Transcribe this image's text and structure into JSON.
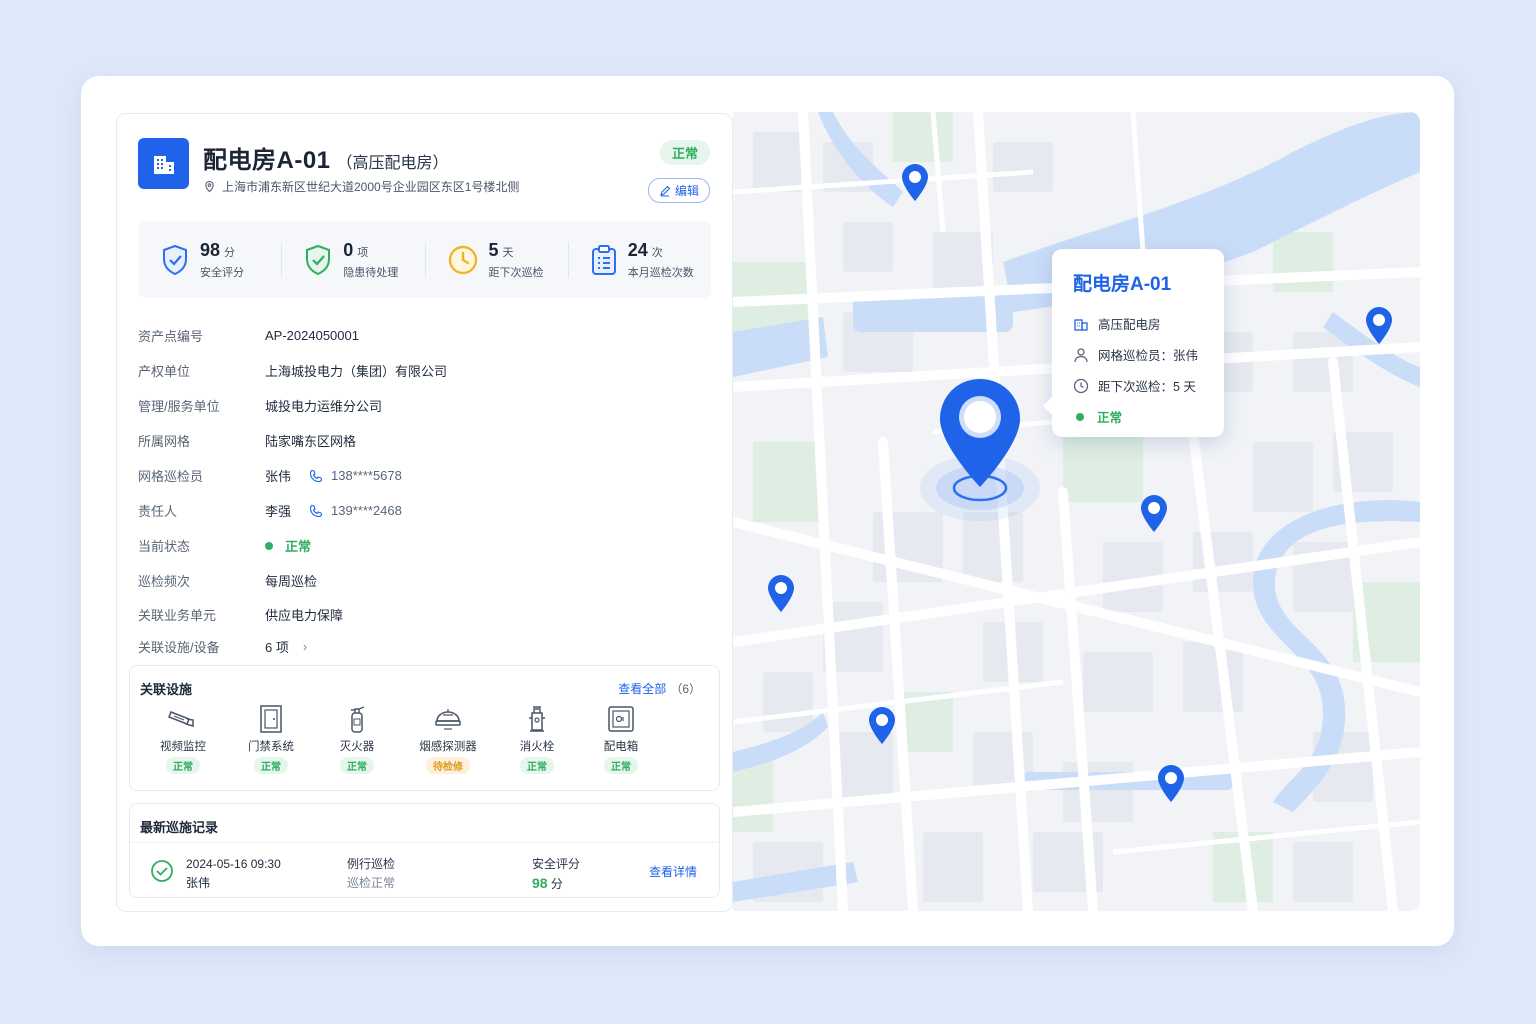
{
  "header": {
    "title": "配电房A-01",
    "subtitle": "（高压配电房）",
    "address": "上海市浦东新区世纪大道2000号企业园区东区1号楼北侧",
    "status": "正常",
    "edit_label": "编辑",
    "icon": "building-icon"
  },
  "stats": [
    {
      "value": "98",
      "unit": "分",
      "label": "安全评分",
      "icon": "shield-check-icon",
      "color": "#2d6ff0"
    },
    {
      "value": "0",
      "unit": "项",
      "label": "隐患待处理",
      "icon": "shield-ok-icon",
      "color": "#2fae5f"
    },
    {
      "value": "5",
      "unit": "天",
      "label": "距下次巡检",
      "icon": "clock-icon",
      "color": "#f0b429"
    },
    {
      "value": "24",
      "unit": "次",
      "label": "本月巡检次数",
      "icon": "clipboard-icon",
      "color": "#2d6ff0"
    }
  ],
  "fields": {
    "asset_no": {
      "label": "资产点编号",
      "value": "AP-2024050001"
    },
    "owner": {
      "label": "产权单位",
      "value": "上海城投电力（集团）有限公司"
    },
    "manager": {
      "label": "管理/服务单位",
      "value": "城投电力运维分公司"
    },
    "grid": {
      "label": "所属网格",
      "value": "陆家嘴东区网格"
    },
    "inspector": {
      "label": "网格巡检员",
      "value": "张伟",
      "phone": "138****5678"
    },
    "responsible": {
      "label": "责任人",
      "value": "李强",
      "phone": "139****2468"
    },
    "status": {
      "label": "当前状态",
      "value": "正常"
    },
    "frequency": {
      "label": "巡检频次",
      "value": "每周巡检"
    },
    "business": {
      "label": "关联业务单元",
      "value": "供应电力保障"
    },
    "devices": {
      "label": "关联设施/设备",
      "value": "6 项"
    }
  },
  "facilities": {
    "title": "关联设施",
    "see_all": "查看全部",
    "count": "（6）",
    "items": [
      {
        "name": "视频监控",
        "status": "正常",
        "icon": "camera-icon"
      },
      {
        "name": "门禁系统",
        "status": "正常",
        "icon": "door-icon"
      },
      {
        "name": "灭火器",
        "status": "正常",
        "icon": "extinguisher-icon"
      },
      {
        "name": "烟感探测器",
        "status": "待检修",
        "icon": "smoke-detector-icon"
      },
      {
        "name": "消火栓",
        "status": "正常",
        "icon": "hydrant-icon"
      },
      {
        "name": "配电箱",
        "status": "正常",
        "icon": "distribution-box-icon"
      }
    ]
  },
  "records": {
    "title": "最新巡施记录",
    "latest": {
      "time": "2024-05-16 09:30",
      "person": "张伟",
      "type": "例行巡检",
      "result": "巡检正常",
      "score_label": "安全评分",
      "score": "98",
      "score_unit": "分",
      "link": "查看详情"
    }
  },
  "popup": {
    "title": "配电房A-01",
    "type": "高压配电房",
    "inspector": "网格巡检员：张伟",
    "next": "距下次巡检：5 天",
    "status": "正常"
  },
  "colors": {
    "primary": "#1f63e8",
    "success": "#2fae5f",
    "warning": "#e29b1f",
    "water": "#c9dcf8",
    "park": "#dfeee2"
  }
}
